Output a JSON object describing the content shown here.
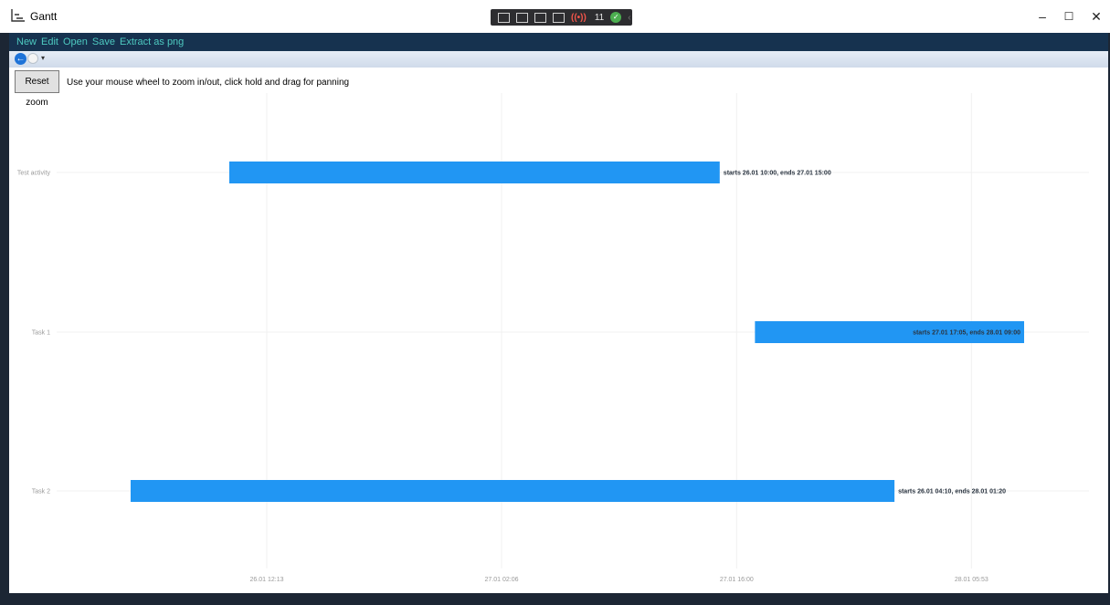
{
  "window": {
    "title": "Gantt",
    "debug_toolbar": {
      "count": "11"
    },
    "controls": {
      "minimize": "–",
      "maximize": "☐",
      "close": "✕"
    }
  },
  "menu": {
    "items": [
      "New",
      "Edit",
      "Open",
      "Save",
      "Extract as png"
    ]
  },
  "toolbar": {
    "reset_zoom": "Reset zoom",
    "hint": "Use your mouse wheel to zoom in/out, click hold and drag for panning"
  },
  "colors": {
    "bar": "#2196f3",
    "menu_text": "#4ec9c0",
    "menu_bg": "#16324f",
    "frame": "#1c2634"
  },
  "chart_data": {
    "type": "gantt",
    "x_ticks": [
      "26.01 12:13",
      "27.01 02:06",
      "27.01 16:00",
      "28.01 05:53"
    ],
    "tasks": [
      {
        "name": "Test activity",
        "start": "26.01 10:00",
        "end": "27.01 15:00",
        "label": "starts 26.01 10:00, ends 27.01 15:00"
      },
      {
        "name": "Task 1",
        "start": "27.01 17:05",
        "end": "28.01 09:00",
        "label": "starts 27.01 17:05, ends 28.01 09:00"
      },
      {
        "name": "Task 2",
        "start": "26.01 04:10",
        "end": "28.01 01:20",
        "label": "starts 26.01 04:10, ends 28.01 01:20"
      }
    ]
  }
}
